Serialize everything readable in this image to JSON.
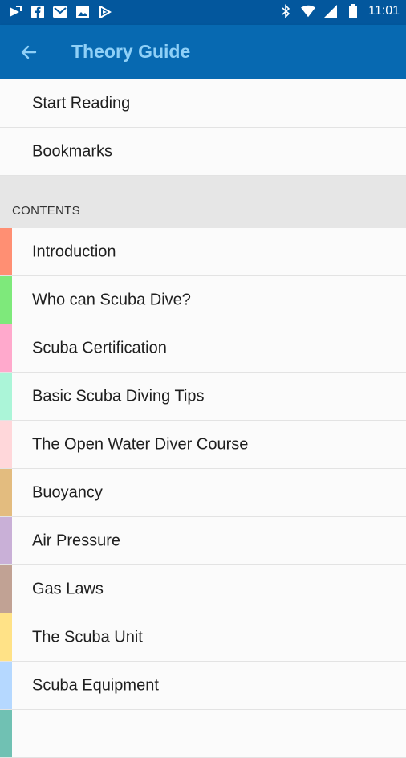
{
  "status": {
    "time": "11:01"
  },
  "appbar": {
    "title": "Theory Guide"
  },
  "actions": [
    {
      "label": "Start Reading"
    },
    {
      "label": "Bookmarks"
    }
  ],
  "contents_header": "CONTENTS",
  "contents": [
    {
      "label": "Introduction",
      "color": "#ff8f73"
    },
    {
      "label": "Who can Scuba Dive?",
      "color": "#7ee97b"
    },
    {
      "label": "Scuba Certification",
      "color": "#ffa9cc"
    },
    {
      "label": "Basic Scuba Diving Tips",
      "color": "#abf5d8"
    },
    {
      "label": "The Open Water Diver Course",
      "color": "#ffd7da"
    },
    {
      "label": "Buoyancy",
      "color": "#e3bc7f"
    },
    {
      "label": "Air Pressure",
      "color": "#c9b0d7"
    },
    {
      "label": "Gas Laws",
      "color": "#c1a294"
    },
    {
      "label": "The Scuba Unit",
      "color": "#ffe287"
    },
    {
      "label": "Scuba Equipment",
      "color": "#b5d8ff"
    },
    {
      "label": "",
      "color": "#70c1b3"
    }
  ]
}
